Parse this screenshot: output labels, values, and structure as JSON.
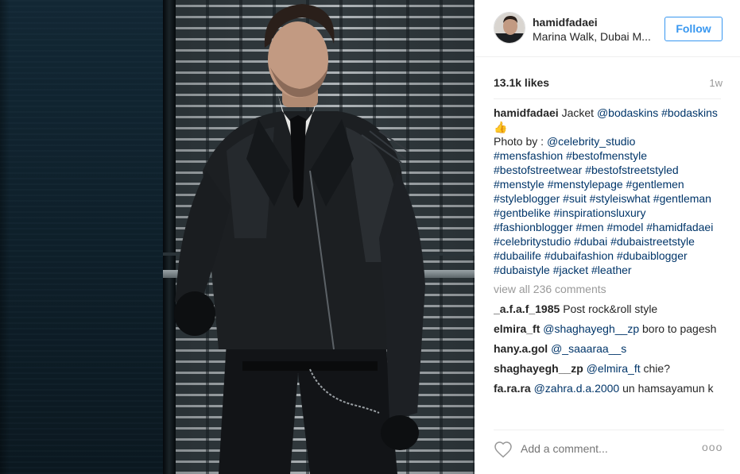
{
  "header": {
    "username": "hamidfadaei",
    "location": "Marina Walk, Dubai M...",
    "follow_label": "Follow"
  },
  "stats": {
    "likes": "13.1k likes",
    "time": "1w"
  },
  "caption": {
    "username": "hamidfadaei",
    "text": "Jacket",
    "mention_brand": "@bodaskins",
    "tag_brand": "#bodaskins",
    "emoji": "👍",
    "photo_prefix": "Photo by :",
    "photo_by": "@celebrity_studio",
    "hashtags": [
      "#mensfashion",
      "#bestofmenstyle",
      "#bestofstreetwear",
      "#bestofstreetstyled",
      "#menstyle",
      "#menstylepage",
      "#gentlemen",
      "#styleblogger",
      "#suit",
      "#styleiswhat",
      "#gentleman",
      "#gentbelike",
      "#inspirationsluxury",
      "#fashionblogger",
      "#men",
      "#model",
      "#hamidfadaei",
      "#celebritystudio",
      "#dubai",
      "#dubaistreetstyle",
      "#dubailife",
      "#dubaifashion",
      "#dubaiblogger",
      "#dubaistyle",
      "#jacket",
      "#leather"
    ]
  },
  "view_all_label": "view all 236 comments",
  "comments": [
    {
      "user": "_a.f.a.f_1985",
      "mention": "",
      "text": "Post rock&roll style"
    },
    {
      "user": "elmira_ft",
      "mention": "@shaghayegh__zp",
      "text": "boro to pagesh"
    },
    {
      "user": "hany.a.gol",
      "mention": "@_saaaraa__s",
      "text": ""
    },
    {
      "user": "shaghayegh__zp",
      "mention": "@elmira_ft",
      "text": "chie?"
    },
    {
      "user": "fa.ra.ra",
      "mention": "@zahra.d.a.2000",
      "text": "un hamsayamun k"
    }
  ],
  "footer": {
    "add_comment_placeholder": "Add a comment...",
    "more_label": "ooo"
  },
  "colors": {
    "accent": "#3897f0",
    "hashtag": "#003569",
    "muted": "#999999",
    "text": "#262626"
  },
  "icons": [
    "heart-icon",
    "more-options-icon"
  ]
}
